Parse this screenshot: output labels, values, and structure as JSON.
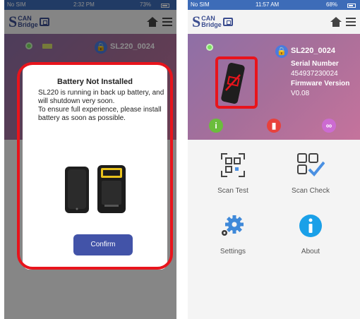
{
  "left_screen": {
    "status": {
      "carrier": "No SIM",
      "time": "2:32 PM",
      "battery": "73%"
    },
    "device_name": "SL220_0024",
    "dialog": {
      "title": "Battery Not Installed",
      "message": "SL220 is running in back up battery, and will shutdown very soon.\nTo ensure full experience, please install battery as soon as possible.",
      "confirm_label": "Confirm"
    }
  },
  "right_screen": {
    "status": {
      "carrier": "No SIM",
      "time": "11:57 AM",
      "battery": "68%"
    },
    "device_name": "SL220_0024",
    "serial_label": "Serial Number",
    "serial_value": "454937230024",
    "firmware_label": "Firmware Version",
    "firmware_value": "V0.08",
    "tiles": [
      {
        "label": "Scan Test"
      },
      {
        "label": "Scan Check"
      },
      {
        "label": "Settings"
      },
      {
        "label": "About"
      }
    ]
  },
  "logo": {
    "top": "CAN",
    "bottom": "Bridge",
    "letter": "S"
  },
  "colors": {
    "accent": "#3b4d8f",
    "highlight": "#e8141c",
    "confirm": "#4253a8",
    "online": "#7be05f"
  }
}
